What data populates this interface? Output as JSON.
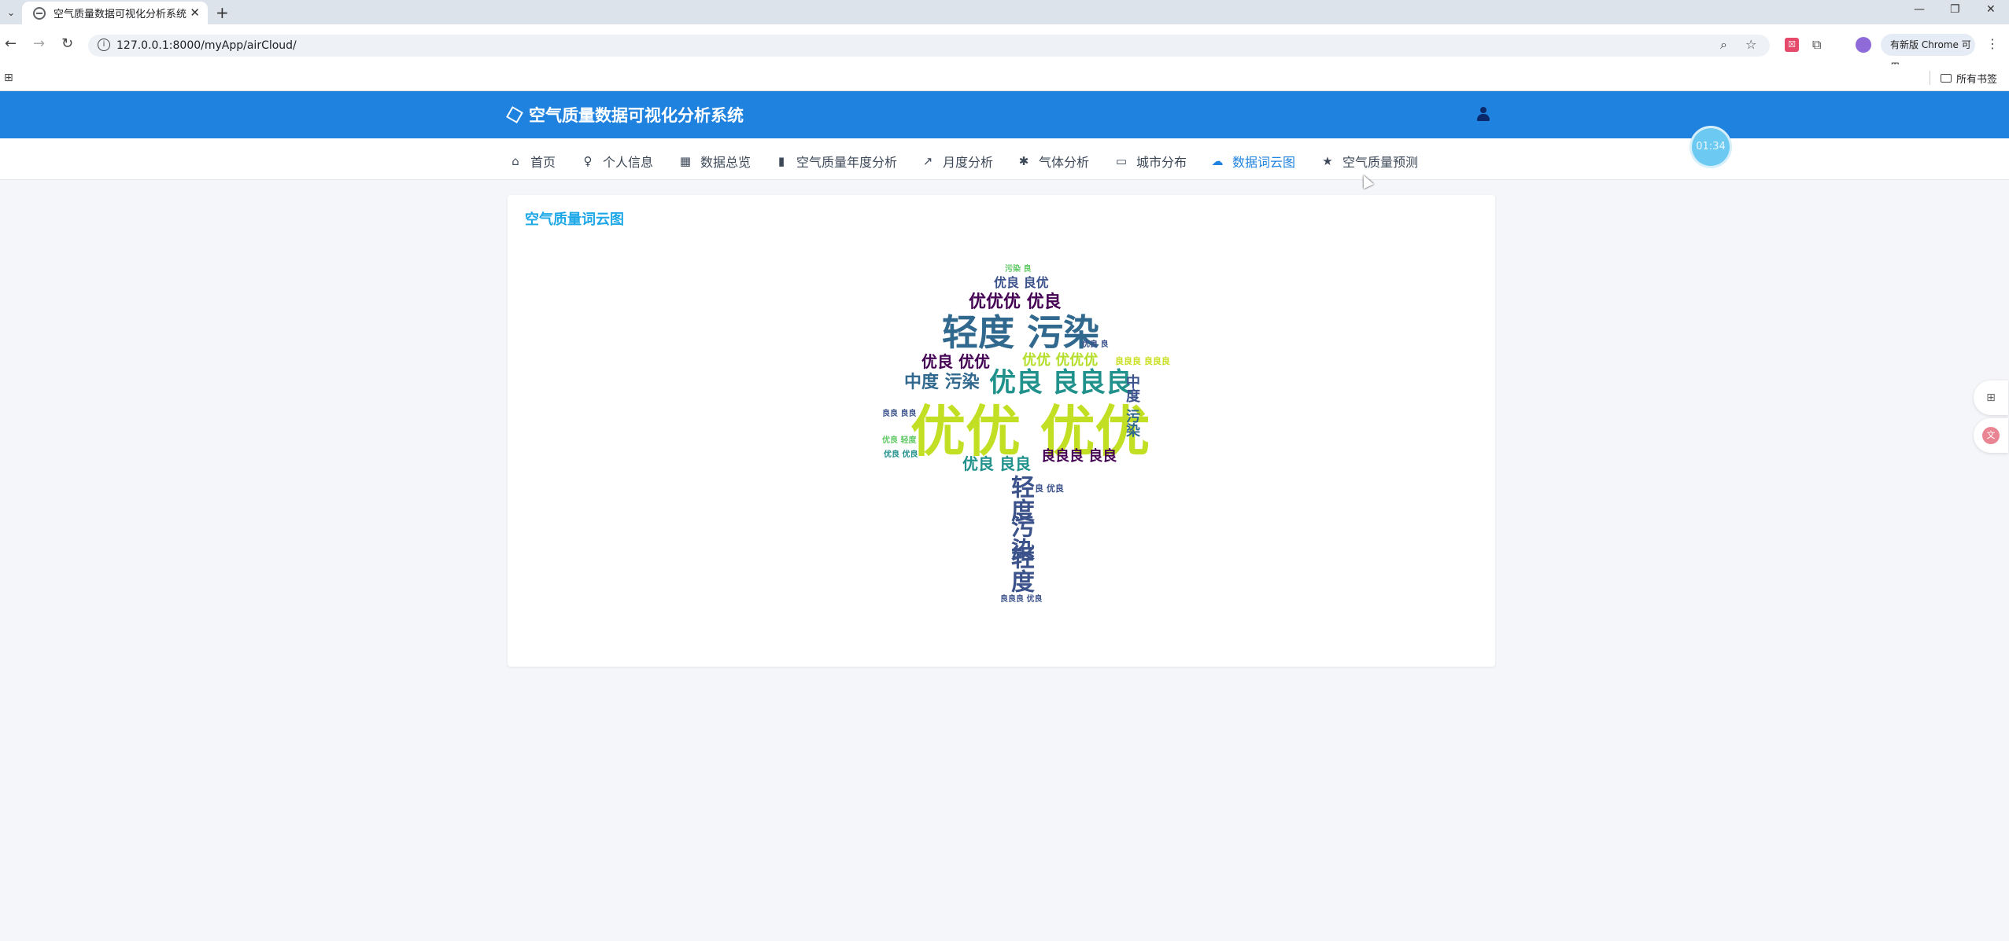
{
  "browser": {
    "tab_title": "空气质量数据可视化分析系统",
    "url": "127.0.0.1:8000/myApp/airCloud/",
    "update_label": "有新版 Chrome 可用",
    "all_bookmarks": "所有书签"
  },
  "app": {
    "title": "空气质量数据可视化分析系统",
    "nav": [
      {
        "label": "首页",
        "icon": "home-icon"
      },
      {
        "label": "个人信息",
        "icon": "person-icon"
      },
      {
        "label": "数据总览",
        "icon": "table-icon"
      },
      {
        "label": "空气质量年度分析",
        "icon": "bar-chart-icon"
      },
      {
        "label": "月度分析",
        "icon": "line-chart-icon"
      },
      {
        "label": "气体分析",
        "icon": "ac-icon"
      },
      {
        "label": "城市分布",
        "icon": "map-icon"
      },
      {
        "label": "数据词云图",
        "icon": "cloud-icon"
      },
      {
        "label": "空气质量预测",
        "icon": "star-icon"
      }
    ],
    "active_nav": "数据词云图",
    "timer": "01:34",
    "accent": "#1f82df"
  },
  "card": {
    "title": "空气质量词云图"
  },
  "wordcloud": {
    "words": [
      {
        "text": "污染 良",
        "color": "#5ec962"
      },
      {
        "text": "优良 良优",
        "color": "#3b528b"
      },
      {
        "text": "优优优 优良",
        "color": "#440154"
      },
      {
        "text": "轻度 污染",
        "color": "#31688e"
      },
      {
        "text": "优良 良",
        "color": "#3b528b"
      },
      {
        "text": "优良 优优",
        "color": "#440154"
      },
      {
        "text": "优优 优优优",
        "color": "#b5de2b"
      },
      {
        "text": "良良良 良良良",
        "color": "#c9e020"
      },
      {
        "text": "中度 污染",
        "color": "#31688e"
      },
      {
        "text": "优良 良良良",
        "color": "#21918c"
      },
      {
        "text": "优优 优优",
        "color": "#c2df23"
      },
      {
        "text": "良良 良良",
        "color": "#3b528b"
      },
      {
        "text": "优良 轻度",
        "color": "#5ec962"
      },
      {
        "text": "优良 优良",
        "color": "#21918c"
      },
      {
        "text": "优良 良良",
        "color": "#21918c"
      },
      {
        "text": "良良良 良良",
        "color": "#440154"
      },
      {
        "text": "中度",
        "color": "#3b528b"
      },
      {
        "text": "污染",
        "color": "#31688e"
      },
      {
        "text": "轻度",
        "color": "#3b528b"
      },
      {
        "text": "污染",
        "color": "#3b528b"
      },
      {
        "text": "轻度",
        "color": "#3b528b"
      },
      {
        "text": "良良良 优良",
        "color": "#3b528b"
      },
      {
        "text": "良 优良",
        "color": "#3b528b"
      }
    ]
  }
}
